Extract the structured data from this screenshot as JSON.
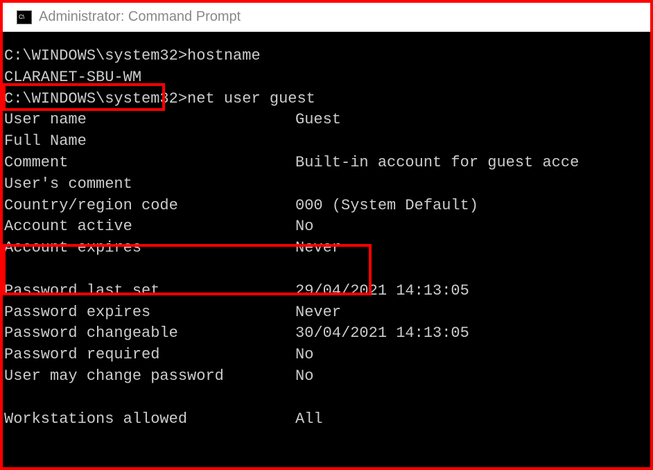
{
  "title_bar": {
    "icon_text": "C:\\",
    "title": "Administrator: Command Prompt"
  },
  "terminal": {
    "prompt1": "C:\\WINDOWS\\system32>hostname",
    "hostname": "CLARANET-SBU-WM",
    "blank1": "",
    "prompt2": "C:\\WINDOWS\\system32>net user guest",
    "rows": [
      {
        "label": "User name",
        "value": "Guest"
      },
      {
        "label": "Full Name",
        "value": ""
      },
      {
        "label": "Comment",
        "value": "Built-in account for guest acce"
      },
      {
        "label": "User's comment",
        "value": ""
      },
      {
        "label": "Country/region code",
        "value": "000 (System Default)"
      },
      {
        "label": "Account active",
        "value": "No"
      },
      {
        "label": "Account expires",
        "value": "Never"
      }
    ],
    "rows2": [
      {
        "label": "Password last set",
        "value": "29/04/2021 14:13:05"
      },
      {
        "label": "Password expires",
        "value": "Never"
      },
      {
        "label": "Password changeable",
        "value": "30/04/2021 14:13:05"
      },
      {
        "label": "Password required",
        "value": "No"
      },
      {
        "label": "User may change password",
        "value": "No"
      }
    ],
    "rows3": [
      {
        "label": "Workstations allowed",
        "value": "All"
      }
    ]
  }
}
